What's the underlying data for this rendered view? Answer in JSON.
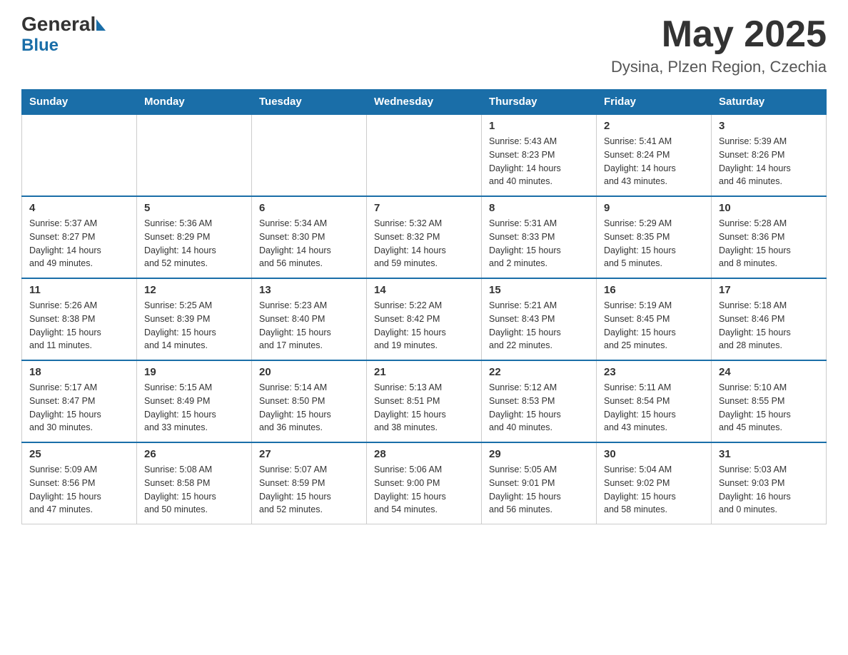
{
  "header": {
    "logo": {
      "general": "General",
      "blue": "Blue"
    },
    "month_year": "May 2025",
    "location": "Dysina, Plzen Region, Czechia"
  },
  "days_of_week": [
    "Sunday",
    "Monday",
    "Tuesday",
    "Wednesday",
    "Thursday",
    "Friday",
    "Saturday"
  ],
  "weeks": [
    [
      {
        "day": "",
        "info": ""
      },
      {
        "day": "",
        "info": ""
      },
      {
        "day": "",
        "info": ""
      },
      {
        "day": "",
        "info": ""
      },
      {
        "day": "1",
        "info": "Sunrise: 5:43 AM\nSunset: 8:23 PM\nDaylight: 14 hours\nand 40 minutes."
      },
      {
        "day": "2",
        "info": "Sunrise: 5:41 AM\nSunset: 8:24 PM\nDaylight: 14 hours\nand 43 minutes."
      },
      {
        "day": "3",
        "info": "Sunrise: 5:39 AM\nSunset: 8:26 PM\nDaylight: 14 hours\nand 46 minutes."
      }
    ],
    [
      {
        "day": "4",
        "info": "Sunrise: 5:37 AM\nSunset: 8:27 PM\nDaylight: 14 hours\nand 49 minutes."
      },
      {
        "day": "5",
        "info": "Sunrise: 5:36 AM\nSunset: 8:29 PM\nDaylight: 14 hours\nand 52 minutes."
      },
      {
        "day": "6",
        "info": "Sunrise: 5:34 AM\nSunset: 8:30 PM\nDaylight: 14 hours\nand 56 minutes."
      },
      {
        "day": "7",
        "info": "Sunrise: 5:32 AM\nSunset: 8:32 PM\nDaylight: 14 hours\nand 59 minutes."
      },
      {
        "day": "8",
        "info": "Sunrise: 5:31 AM\nSunset: 8:33 PM\nDaylight: 15 hours\nand 2 minutes."
      },
      {
        "day": "9",
        "info": "Sunrise: 5:29 AM\nSunset: 8:35 PM\nDaylight: 15 hours\nand 5 minutes."
      },
      {
        "day": "10",
        "info": "Sunrise: 5:28 AM\nSunset: 8:36 PM\nDaylight: 15 hours\nand 8 minutes."
      }
    ],
    [
      {
        "day": "11",
        "info": "Sunrise: 5:26 AM\nSunset: 8:38 PM\nDaylight: 15 hours\nand 11 minutes."
      },
      {
        "day": "12",
        "info": "Sunrise: 5:25 AM\nSunset: 8:39 PM\nDaylight: 15 hours\nand 14 minutes."
      },
      {
        "day": "13",
        "info": "Sunrise: 5:23 AM\nSunset: 8:40 PM\nDaylight: 15 hours\nand 17 minutes."
      },
      {
        "day": "14",
        "info": "Sunrise: 5:22 AM\nSunset: 8:42 PM\nDaylight: 15 hours\nand 19 minutes."
      },
      {
        "day": "15",
        "info": "Sunrise: 5:21 AM\nSunset: 8:43 PM\nDaylight: 15 hours\nand 22 minutes."
      },
      {
        "day": "16",
        "info": "Sunrise: 5:19 AM\nSunset: 8:45 PM\nDaylight: 15 hours\nand 25 minutes."
      },
      {
        "day": "17",
        "info": "Sunrise: 5:18 AM\nSunset: 8:46 PM\nDaylight: 15 hours\nand 28 minutes."
      }
    ],
    [
      {
        "day": "18",
        "info": "Sunrise: 5:17 AM\nSunset: 8:47 PM\nDaylight: 15 hours\nand 30 minutes."
      },
      {
        "day": "19",
        "info": "Sunrise: 5:15 AM\nSunset: 8:49 PM\nDaylight: 15 hours\nand 33 minutes."
      },
      {
        "day": "20",
        "info": "Sunrise: 5:14 AM\nSunset: 8:50 PM\nDaylight: 15 hours\nand 36 minutes."
      },
      {
        "day": "21",
        "info": "Sunrise: 5:13 AM\nSunset: 8:51 PM\nDaylight: 15 hours\nand 38 minutes."
      },
      {
        "day": "22",
        "info": "Sunrise: 5:12 AM\nSunset: 8:53 PM\nDaylight: 15 hours\nand 40 minutes."
      },
      {
        "day": "23",
        "info": "Sunrise: 5:11 AM\nSunset: 8:54 PM\nDaylight: 15 hours\nand 43 minutes."
      },
      {
        "day": "24",
        "info": "Sunrise: 5:10 AM\nSunset: 8:55 PM\nDaylight: 15 hours\nand 45 minutes."
      }
    ],
    [
      {
        "day": "25",
        "info": "Sunrise: 5:09 AM\nSunset: 8:56 PM\nDaylight: 15 hours\nand 47 minutes."
      },
      {
        "day": "26",
        "info": "Sunrise: 5:08 AM\nSunset: 8:58 PM\nDaylight: 15 hours\nand 50 minutes."
      },
      {
        "day": "27",
        "info": "Sunrise: 5:07 AM\nSunset: 8:59 PM\nDaylight: 15 hours\nand 52 minutes."
      },
      {
        "day": "28",
        "info": "Sunrise: 5:06 AM\nSunset: 9:00 PM\nDaylight: 15 hours\nand 54 minutes."
      },
      {
        "day": "29",
        "info": "Sunrise: 5:05 AM\nSunset: 9:01 PM\nDaylight: 15 hours\nand 56 minutes."
      },
      {
        "day": "30",
        "info": "Sunrise: 5:04 AM\nSunset: 9:02 PM\nDaylight: 15 hours\nand 58 minutes."
      },
      {
        "day": "31",
        "info": "Sunrise: 5:03 AM\nSunset: 9:03 PM\nDaylight: 16 hours\nand 0 minutes."
      }
    ]
  ]
}
